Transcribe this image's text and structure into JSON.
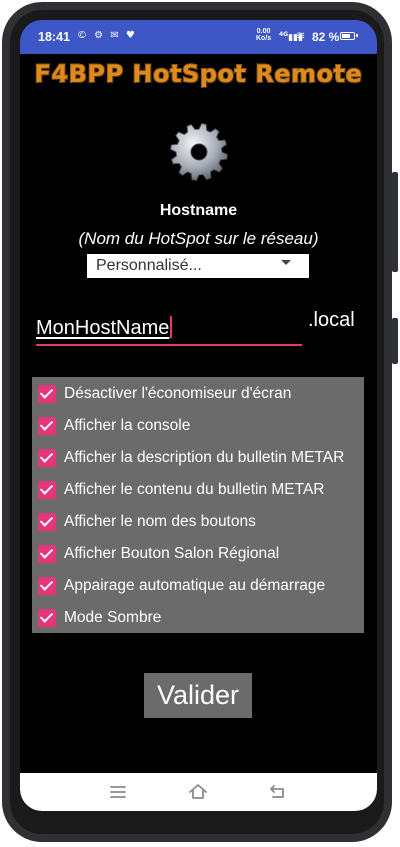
{
  "status_bar": {
    "time": "18:41",
    "notification_icons": "© ⚙ ✉ ♥",
    "net_speed_value": "0.00",
    "net_speed_unit": "Ko/s",
    "signal": "4G",
    "battery_percent": "82 %",
    "battery_level": 0.82
  },
  "app": {
    "title": "F4BPP HotSpot Remote",
    "hostname_label": "Hostname",
    "hostname_subtitle": "(Nom du HotSpot sur le réseau)",
    "hostname_select_value": "Personnalisé...",
    "hostname_input_value": "MonHostName",
    "domain_suffix": ".local",
    "options": [
      {
        "label": "Désactiver l'économiseur d'écran",
        "checked": true
      },
      {
        "label": "Afficher la console",
        "checked": true
      },
      {
        "label": "Afficher la description du bulletin METAR",
        "checked": true
      },
      {
        "label": "Afficher le contenu du bulletin METAR",
        "checked": true
      },
      {
        "label": "Afficher le nom des  boutons",
        "checked": true
      },
      {
        "label": "Afficher Bouton Salon Régional",
        "checked": true
      },
      {
        "label": "Appairage automatique au démarrage",
        "checked": true
      },
      {
        "label": "Mode Sombre",
        "checked": true
      }
    ],
    "validate_label": "Valider"
  },
  "colors": {
    "status_bar": "#3d57c7",
    "accent": "#e6367a",
    "title": "#e08a1e",
    "panel": "#6b6b6b"
  },
  "nav_bar": {
    "icons": [
      "menu-icon",
      "home-icon",
      "back-icon"
    ]
  }
}
